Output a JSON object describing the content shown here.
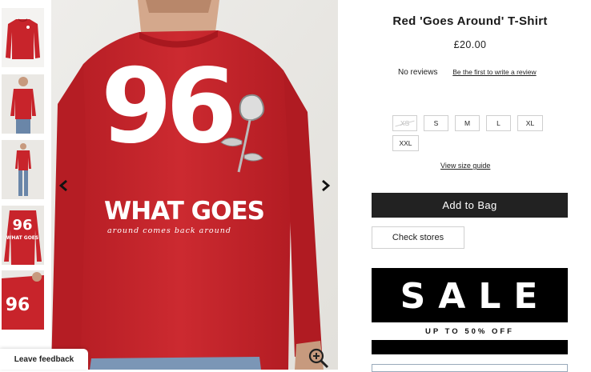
{
  "product": {
    "title": "Red 'Goes Around' T-Shirt",
    "price": "£20.00"
  },
  "reviews": {
    "count_text": "No reviews",
    "cta": "Be the first to write a review"
  },
  "sizes": [
    {
      "label": "XS",
      "available": false
    },
    {
      "label": "S",
      "available": true
    },
    {
      "label": "M",
      "available": true
    },
    {
      "label": "L",
      "available": true
    },
    {
      "label": "XL",
      "available": true
    },
    {
      "label": "XXL",
      "available": true
    }
  ],
  "size_guide": "View size guide",
  "actions": {
    "add_to_bag": "Add to Bag",
    "check_stores": "Check stores"
  },
  "promo": {
    "headline": "SALE",
    "subline": "UP TO 50% OFF"
  },
  "gallery": {
    "print_number": "96",
    "print_text": "WHAT GOES",
    "print_script": "around comes back around",
    "icons": [
      "chevron-left-icon",
      "chevron-right-icon",
      "zoom-in-icon"
    ]
  },
  "feedback": "Leave feedback",
  "colors": {
    "shirt_red": "#c8242b",
    "button_dark": "#222222"
  }
}
